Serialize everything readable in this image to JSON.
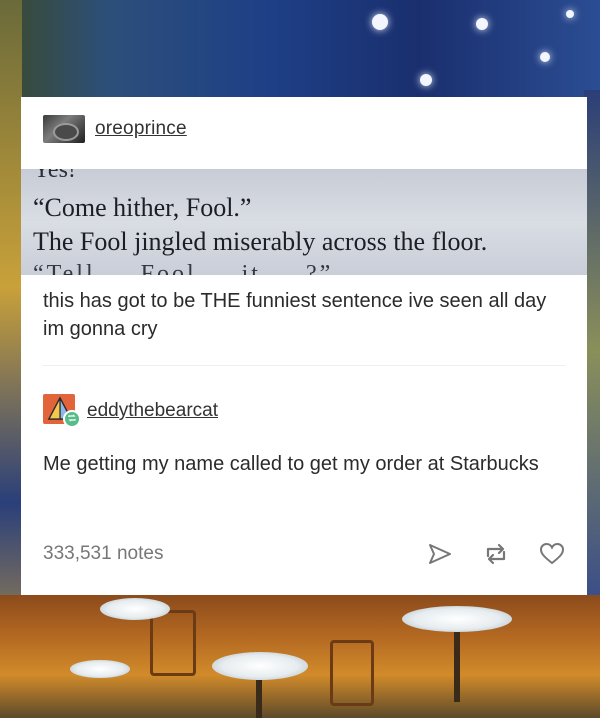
{
  "post": {
    "author": "oreoprince",
    "book_excerpt": {
      "cut_top_line": "Yes!",
      "line_1": "“Come hither, Fool.”",
      "line_2": "The Fool jingled miserably across the floor.",
      "cut_bottom_line": "“Tell … Fool … it … ?”"
    },
    "caption": "this has got to be THE funniest sentence ive seen all day im gonna cry"
  },
  "reblog": {
    "author": "eddythebearcat",
    "text": "Me getting my name called to get my order at Starbucks"
  },
  "footer": {
    "notes": "333,531 notes",
    "icons": [
      "share-icon",
      "reblog-icon",
      "like-icon"
    ]
  },
  "colors": {
    "reblog_avatar": "#e2643b",
    "reblog_badge": "#56bc8a",
    "card": "#ffffff"
  }
}
